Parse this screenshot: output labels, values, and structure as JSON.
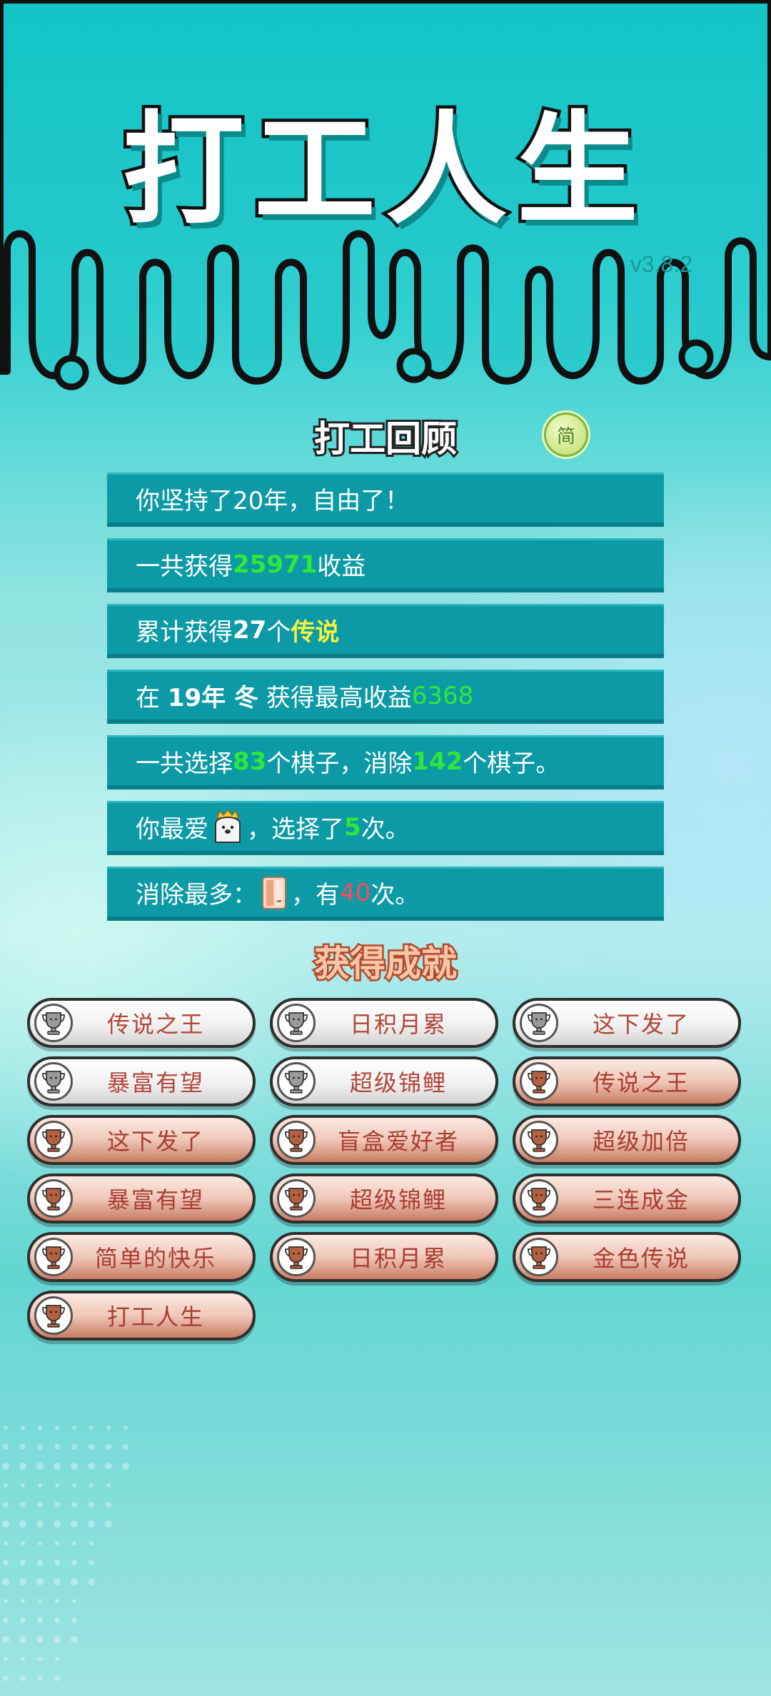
{
  "game": {
    "title": "打工人生",
    "version": "v3.8.2"
  },
  "review": {
    "title": "打工回顾",
    "lang_button": "简",
    "row1": {
      "text": "你坚持了20年，自由了！"
    },
    "row2": {
      "prefix": "一共获得",
      "value": "25971",
      "suffix": "收益"
    },
    "row3": {
      "prefix": "累计获得",
      "count": "27",
      "unit": "个",
      "tier": "传说"
    },
    "row4": {
      "in": "在 ",
      "year": "19年 冬",
      "mid": " 获得最高收益",
      "value": "6368"
    },
    "row5": {
      "prefix": "一共选择",
      "picked": "83",
      "mid": "个棋子，消除",
      "removed": "142",
      "suffix": "个棋子。"
    },
    "row6": {
      "prefix": "你最爱",
      "mid": "，选择了",
      "count": "5",
      "suffix": "次。"
    },
    "row7": {
      "prefix": "消除最多：",
      "mid": "，有",
      "count": "40",
      "suffix": "次。"
    }
  },
  "achievements": {
    "title": "获得成就",
    "items": [
      {
        "label": "传说之王",
        "tier": "silver"
      },
      {
        "label": "日积月累",
        "tier": "silver"
      },
      {
        "label": "这下发了",
        "tier": "silver"
      },
      {
        "label": "暴富有望",
        "tier": "silver"
      },
      {
        "label": "超级锦鲤",
        "tier": "silver"
      },
      {
        "label": "传说之王",
        "tier": "bronze"
      },
      {
        "label": "这下发了",
        "tier": "bronze"
      },
      {
        "label": "盲盒爱好者",
        "tier": "bronze"
      },
      {
        "label": "超级加倍",
        "tier": "bronze"
      },
      {
        "label": "暴富有望",
        "tier": "bronze"
      },
      {
        "label": "超级锦鲤",
        "tier": "bronze"
      },
      {
        "label": "三连成金",
        "tier": "bronze"
      },
      {
        "label": "简单的快乐",
        "tier": "bronze"
      },
      {
        "label": "日积月累",
        "tier": "bronze"
      },
      {
        "label": "金色传说",
        "tier": "bronze"
      },
      {
        "label": "打工人生",
        "tier": "bronze"
      }
    ]
  },
  "colors": {
    "highlight_green": "#2ee83a",
    "highlight_yellow": "#f4f240",
    "highlight_red": "#ff4a5a",
    "row_bg": "#0c9aa6",
    "trophy_silver": "#9a9a9a",
    "trophy_bronze": "#b5603e"
  },
  "icons": {
    "favorite_piece": "bear-mascot-icon",
    "most_removed_piece": "book-tile-icon",
    "trophy": "trophy-icon"
  }
}
